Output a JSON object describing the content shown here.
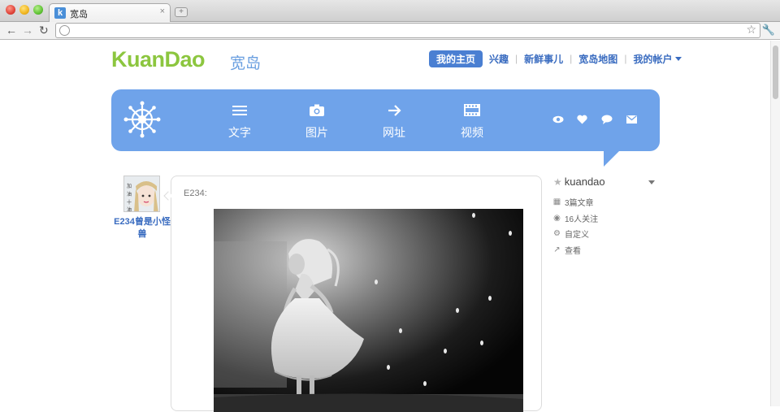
{
  "browser": {
    "tab_title": "宽岛",
    "tab_favicon": "k",
    "tab_close": "×",
    "new_tab": "+"
  },
  "site": {
    "logo_text": "KuanDao",
    "logo_cn": "宽岛"
  },
  "topnav": {
    "active": "我的主页",
    "links": [
      "兴趣",
      "新鲜事儿",
      "宽岛地图",
      "我的帐户"
    ]
  },
  "post_types": [
    {
      "label": "文字",
      "icon": "menu-lines-icon"
    },
    {
      "label": "图片",
      "icon": "camera-icon"
    },
    {
      "label": "网址",
      "icon": "arrow-right-icon"
    },
    {
      "label": "视频",
      "icon": "film-icon"
    }
  ],
  "post": {
    "author_name": "E234曾是小怪兽",
    "header": "E234:"
  },
  "sidebar": {
    "username": "kuandao",
    "items": [
      "3篇文章",
      "16人关注",
      "自定义",
      "查看"
    ]
  },
  "colors": {
    "brand_green": "#8cc63f",
    "brand_blue": "#6fa3ea",
    "link_blue": "#3a6cc0"
  }
}
